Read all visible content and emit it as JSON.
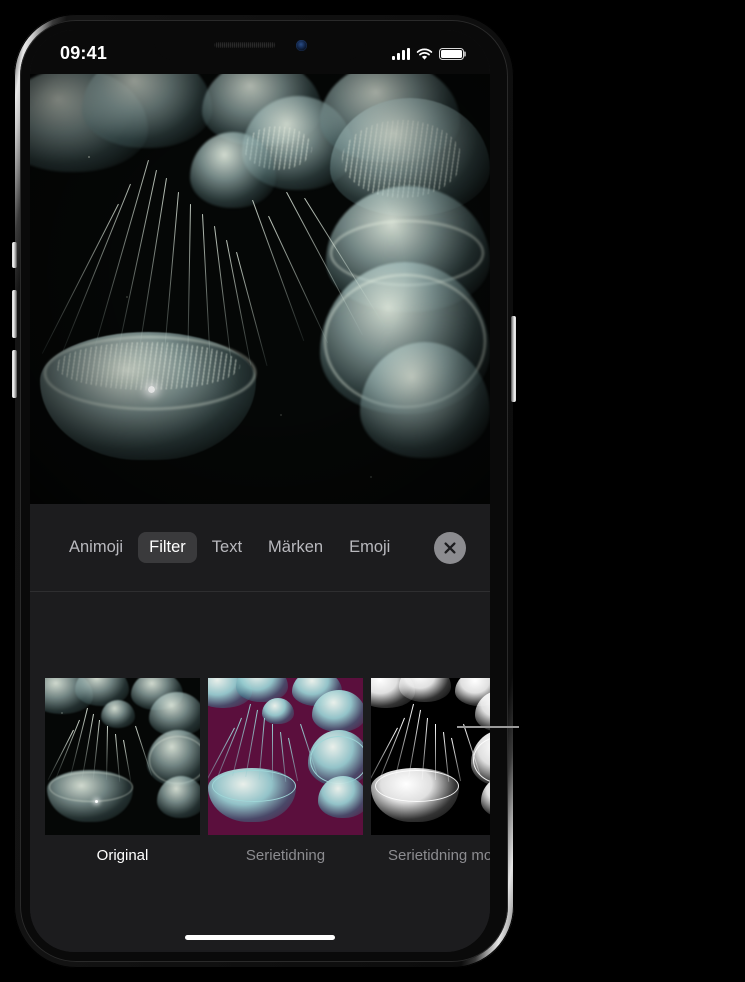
{
  "device": {
    "name": "iPhone",
    "status_bar": {
      "time": "09:41",
      "signal_icon": "cellular-signal-icon",
      "wifi_icon": "wifi-icon",
      "battery_icon": "battery-full-icon",
      "battery_level_percent": 100
    },
    "notch": {
      "speaker_icon": "speaker-grille-icon",
      "camera_icon": "front-camera-icon"
    },
    "buttons": {
      "mute_switch": "mute-switch",
      "volume_up": "volume-up-button",
      "volume_down": "volume-down-button",
      "power": "power-button"
    },
    "home_indicator": "home-indicator"
  },
  "photo": {
    "subject": "jellyfish",
    "description": "Photo of translucent jellyfish in dark water"
  },
  "toolbar": {
    "tabs": [
      {
        "label": "Animoji",
        "selected": false
      },
      {
        "label": "Filter",
        "selected": true
      },
      {
        "label": "Text",
        "selected": false
      },
      {
        "label": "Märken",
        "selected": false
      },
      {
        "label": "Emoji",
        "selected": false
      }
    ],
    "close_button": {
      "icon": "close-x-icon",
      "accessibility_label": "Stäng"
    }
  },
  "filters": [
    {
      "label": "Original",
      "selected": true,
      "style": "original"
    },
    {
      "label": "Serietidning",
      "selected": false,
      "style": "comic"
    },
    {
      "label": "Serietidning mono",
      "selected": false,
      "style": "mono"
    }
  ],
  "callout": {
    "type": "leader-line",
    "points_to": "Serietidning mono"
  },
  "colors": {
    "panel_background": "#1c1c1e",
    "selected_tab_background": "#3a3a3c",
    "selected_label": "#ffffff",
    "unselected_label": "#8c8c90",
    "close_button_background": "#8c8c90",
    "comic_filter_background": "#5b0f3d",
    "callout_line": "#9a9a9a"
  }
}
